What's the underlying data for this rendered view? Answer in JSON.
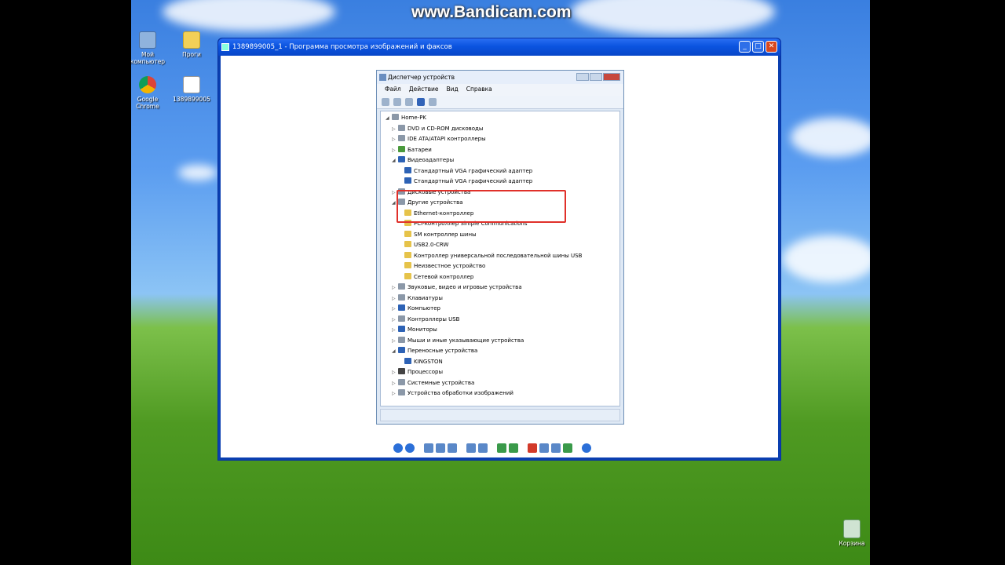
{
  "overlay": {
    "watermark": "www.Bandicam.com"
  },
  "desktop": {
    "icons": [
      {
        "label": "Мой компьютер"
      },
      {
        "label": "Проги"
      },
      {
        "label": "Google Chrome"
      },
      {
        "label": "1389899005"
      }
    ],
    "recycle_bin": "Корзина"
  },
  "viewer": {
    "title": "1389899005_1 - Программа просмотра изображений и факсов",
    "buttons": {
      "minimize": "_",
      "maximize": "□",
      "close": "✕"
    }
  },
  "device_manager": {
    "title": "Диспетчер устройств",
    "menu": [
      "Файл",
      "Действие",
      "Вид",
      "Справка"
    ],
    "tree": [
      {
        "label": "Home-PK",
        "depth": 0,
        "expander": "◢",
        "icon": "gray"
      },
      {
        "label": "DVD и CD-ROM дисководы",
        "depth": 1,
        "expander": "▷",
        "icon": "gray"
      },
      {
        "label": "IDE ATA/ATAPI контроллеры",
        "depth": 1,
        "expander": "▷",
        "icon": "gray"
      },
      {
        "label": "Батареи",
        "depth": 1,
        "expander": "▷",
        "icon": "green"
      },
      {
        "label": "Видеоадаптеры",
        "depth": 1,
        "expander": "◢",
        "icon": "blue"
      },
      {
        "label": "Стандартный VGA графический адаптер",
        "depth": 2,
        "expander": "",
        "icon": "blue"
      },
      {
        "label": "Стандартный VGA графический адаптер",
        "depth": 2,
        "expander": "",
        "icon": "blue"
      },
      {
        "label": "Дисковые устройства",
        "depth": 1,
        "expander": "▷",
        "icon": "gray"
      },
      {
        "label": "Другие устройства",
        "depth": 1,
        "expander": "◢",
        "icon": "gray"
      },
      {
        "label": "Ethernet-контроллер",
        "depth": 2,
        "expander": "",
        "icon": "warn"
      },
      {
        "label": "PCI-контроллер Simple Communications",
        "depth": 2,
        "expander": "",
        "icon": "warn"
      },
      {
        "label": "SM контроллер шины",
        "depth": 2,
        "expander": "",
        "icon": "warn"
      },
      {
        "label": "USB2.0-CRW",
        "depth": 2,
        "expander": "",
        "icon": "warn"
      },
      {
        "label": "Контроллер универсальной последовательной шины USB",
        "depth": 2,
        "expander": "",
        "icon": "warn"
      },
      {
        "label": "Неизвестное устройство",
        "depth": 2,
        "expander": "",
        "icon": "warn"
      },
      {
        "label": "Сетевой контроллер",
        "depth": 2,
        "expander": "",
        "icon": "warn"
      },
      {
        "label": "Звуковые, видео и игровые устройства",
        "depth": 1,
        "expander": "▷",
        "icon": "gray"
      },
      {
        "label": "Клавиатуры",
        "depth": 1,
        "expander": "▷",
        "icon": "gray"
      },
      {
        "label": "Компьютер",
        "depth": 1,
        "expander": "▷",
        "icon": "blue"
      },
      {
        "label": "Контроллеры USB",
        "depth": 1,
        "expander": "▷",
        "icon": "gray"
      },
      {
        "label": "Мониторы",
        "depth": 1,
        "expander": "▷",
        "icon": "blue"
      },
      {
        "label": "Мыши и иные указывающие устройства",
        "depth": 1,
        "expander": "▷",
        "icon": "gray"
      },
      {
        "label": "Переносные устройства",
        "depth": 1,
        "expander": "◢",
        "icon": "blue"
      },
      {
        "label": "KINGSTON",
        "depth": 2,
        "expander": "",
        "icon": "blue"
      },
      {
        "label": "Процессоры",
        "depth": 1,
        "expander": "▷",
        "icon": "dark"
      },
      {
        "label": "Системные устройства",
        "depth": 1,
        "expander": "▷",
        "icon": "gray"
      },
      {
        "label": "Устройства обработки изображений",
        "depth": 1,
        "expander": "▷",
        "icon": "gray"
      }
    ]
  }
}
